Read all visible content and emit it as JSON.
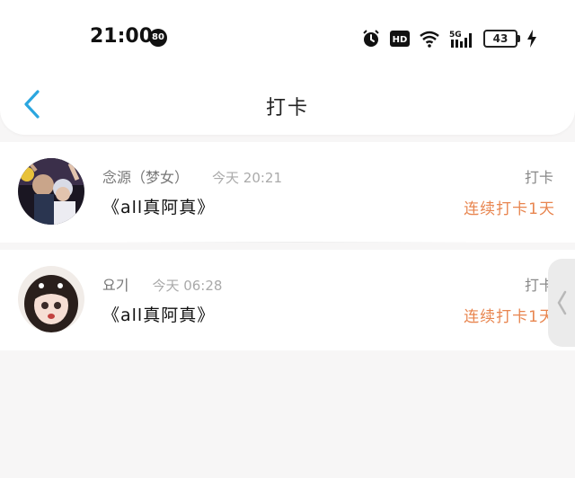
{
  "status_bar": {
    "time": "21:00",
    "notification_count": "80",
    "network": "5G",
    "battery": "43"
  },
  "header": {
    "title": "打卡"
  },
  "records": [
    {
      "name": "念源（梦女）",
      "time": "今天 20:21",
      "book": "《all真阿真》",
      "label": "打卡",
      "streak": "连续打卡1天"
    },
    {
      "name": "요기",
      "time": "今天 06:28",
      "book": "《all真阿真》",
      "label": "打卡",
      "streak": "连续打卡1天"
    }
  ],
  "colors": {
    "accent": "#2aa6df",
    "streak": "#e8854f"
  }
}
